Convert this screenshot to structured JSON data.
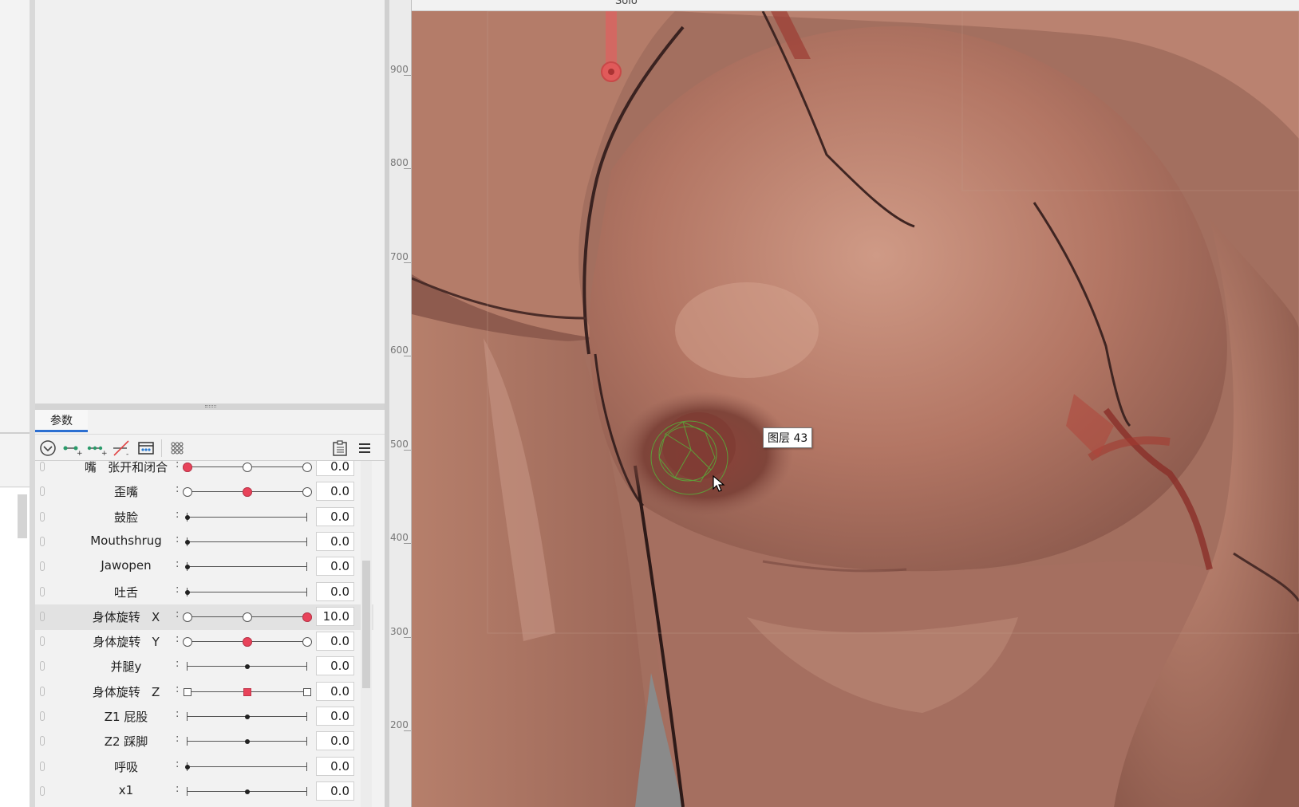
{
  "panel": {
    "tab_label": "参数",
    "toolbar_icons": [
      "collapse-icon",
      "add-key-icon",
      "add-multi-key-icon",
      "delete-key-icon",
      "keyform-icon",
      "grid-dots-icon",
      "clipboard-list-icon",
      "menu-icon"
    ]
  },
  "parameters": [
    {
      "name": "嘴   张开和闭合",
      "value": "0.0",
      "level": 0.0,
      "knob": "red-left"
    },
    {
      "name": "歪嘴",
      "value": "0.0",
      "level": 0.5,
      "knob": "red-mid"
    },
    {
      "name": "鼓脸",
      "value": "0.0",
      "level": 0.0,
      "knob": "dot"
    },
    {
      "name": "Mouthshrug",
      "value": "0.0",
      "level": 0.0,
      "knob": "dot"
    },
    {
      "name": "Jawopen",
      "value": "0.0",
      "level": 0.0,
      "knob": "dot"
    },
    {
      "name": "吐舌",
      "value": "0.0",
      "level": 0.0,
      "knob": "dot"
    },
    {
      "name": "身体旋转   X",
      "value": "10.0",
      "level": 1.0,
      "knob": "red-right",
      "selected": true
    },
    {
      "name": "身体旋转   Y",
      "value": "0.0",
      "level": 0.5,
      "knob": "red-mid"
    },
    {
      "name": "并腿y",
      "value": "0.0",
      "level": 0.5,
      "knob": "dot"
    },
    {
      "name": "身体旋转   Z",
      "value": "0.0",
      "level": 0.5,
      "knob": "square-mid"
    },
    {
      "name": "Z1 屁股",
      "value": "0.0",
      "level": 0.5,
      "knob": "dot"
    },
    {
      "name": "Z2 踩脚",
      "value": "0.0",
      "level": 0.5,
      "knob": "dot"
    },
    {
      "name": "呼吸",
      "value": "0.0",
      "level": 0.0,
      "knob": "dot"
    },
    {
      "name": "x1",
      "value": "0.0",
      "level": 0.5,
      "knob": "dot"
    }
  ],
  "ruler": {
    "labels": [
      "900",
      "800",
      "700",
      "600",
      "500",
      "400",
      "300",
      "200"
    ]
  },
  "canvas": {
    "tooltip": "图层 43",
    "top_label": "Solo",
    "colors": {
      "skin_base": "#b97a68",
      "skin_light": "#d09a84",
      "shadow": "#7a4a40",
      "line": "#3b2220",
      "accent_red": "#b0453a",
      "mesh": "#5aa83a"
    }
  }
}
